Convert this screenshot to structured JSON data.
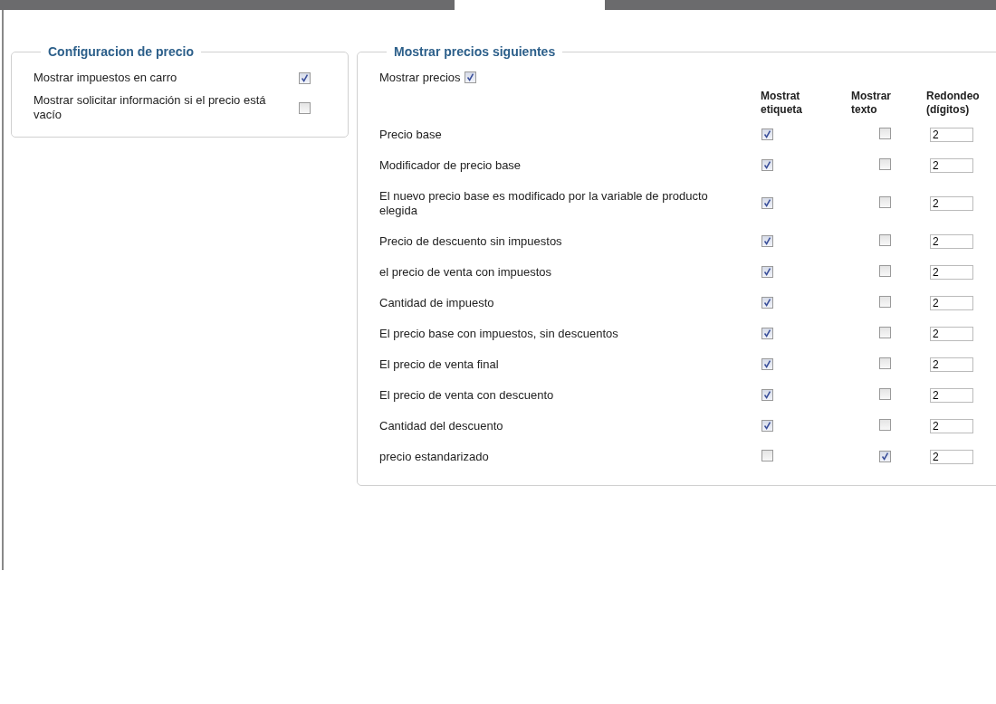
{
  "tabs": [
    {
      "selected": true
    }
  ],
  "price_config": {
    "title": "Configuracion de precio",
    "options": [
      {
        "label": "Mostrar impuestos en carro",
        "checked": true
      },
      {
        "label": "Mostrar solicitar información si el precio está vacío",
        "checked": false
      }
    ]
  },
  "price_display": {
    "title": "Mostrar precios siguientes",
    "show_prices": {
      "label": "Mostrar precios",
      "checked": true
    },
    "columns": [
      "Mostrat etiqueta",
      "Mostrar texto",
      "Redondeo (dígitos)"
    ],
    "rows": [
      {
        "label": "Precio base",
        "show_label": true,
        "show_text": false,
        "rounding": "2"
      },
      {
        "label": "Modificador de precio base",
        "show_label": true,
        "show_text": false,
        "rounding": "2"
      },
      {
        "label": "El nuevo precio base es modificado por la variable de producto elegida",
        "show_label": true,
        "show_text": false,
        "rounding": "2"
      },
      {
        "label": "Precio de descuento sin impuestos",
        "show_label": true,
        "show_text": false,
        "rounding": "2"
      },
      {
        "label": "el precio de venta con impuestos",
        "show_label": true,
        "show_text": false,
        "rounding": "2"
      },
      {
        "label": "Cantidad de impuesto",
        "show_label": true,
        "show_text": false,
        "rounding": "2"
      },
      {
        "label": "El precio base con impuestos, sin descuentos",
        "show_label": true,
        "show_text": false,
        "rounding": "2"
      },
      {
        "label": "El precio de venta final",
        "show_label": true,
        "show_text": false,
        "rounding": "2"
      },
      {
        "label": "El precio de venta con descuento",
        "show_label": true,
        "show_text": false,
        "rounding": "2"
      },
      {
        "label": "Cantidad del descuento",
        "show_label": true,
        "show_text": false,
        "rounding": "2"
      },
      {
        "label": "precio estandarizado",
        "show_label": false,
        "show_text": true,
        "rounding": "2"
      }
    ]
  }
}
